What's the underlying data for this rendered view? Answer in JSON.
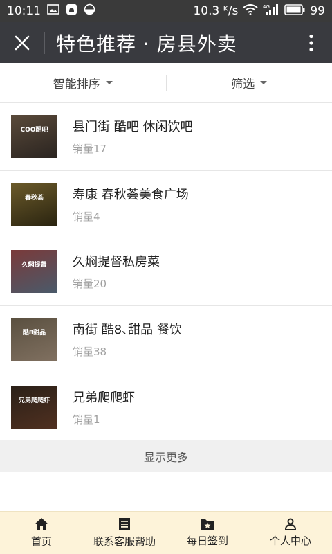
{
  "status_bar": {
    "time": "10:11",
    "speed": "10.3 ᴷ/s",
    "network": "4G",
    "battery": "99"
  },
  "header": {
    "title": "特色推荐 · 房县外卖",
    "close_icon": "close-icon",
    "more_icon": "more-vertical-icon"
  },
  "filters": [
    {
      "label": "智能排序"
    },
    {
      "label": "筛选"
    }
  ],
  "restaurants": [
    {
      "name": "县门街 酷吧 休闲饮吧",
      "sales": "销量17",
      "sign": "COO酷吧",
      "colors": [
        "#5a4a3a",
        "#2a2420"
      ]
    },
    {
      "name": "寿康 春秋荟美食广场",
      "sales": "销量4",
      "sign": "春秋荟",
      "colors": [
        "#6b5a2a",
        "#2a2410"
      ]
    },
    {
      "name": "久焖提督私房菜",
      "sales": "销量20",
      "sign": "久焖提督",
      "colors": [
        "#7a3a3a",
        "#4a5a6a"
      ]
    },
    {
      "name": "南街 酷8､甜品 餐饮",
      "sales": "销量38",
      "sign": "酷8甜品",
      "colors": [
        "#5a5040",
        "#807060"
      ]
    },
    {
      "name": "兄弟爬爬虾",
      "sales": "销量1",
      "sign": "兄弟爬爬虾",
      "colors": [
        "#2a2018",
        "#503020"
      ]
    }
  ],
  "load_more": "显示更多",
  "tabs": [
    {
      "label": "首页",
      "icon": "home-icon"
    },
    {
      "label": "联系客服帮助",
      "icon": "document-icon"
    },
    {
      "label": "每日签到",
      "icon": "star-folder-icon"
    },
    {
      "label": "个人中心",
      "icon": "person-icon"
    }
  ]
}
